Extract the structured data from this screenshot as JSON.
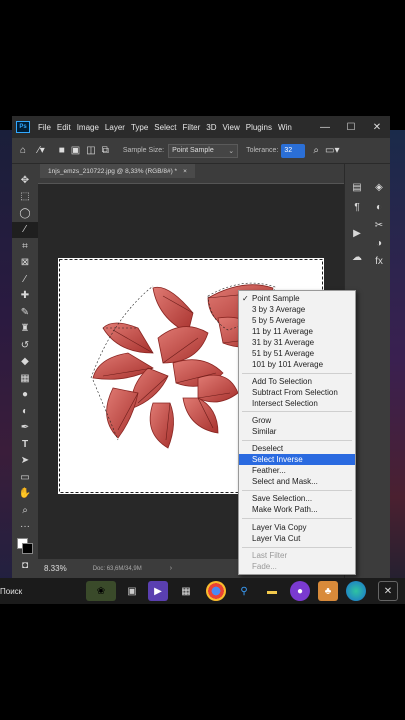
{
  "app": {
    "logo": "Ps",
    "menu": [
      "File",
      "Edit",
      "Image",
      "Layer",
      "Type",
      "Select",
      "Filter",
      "3D",
      "View",
      "Plugins",
      "Win"
    ],
    "window_buttons": [
      "—",
      "☐",
      "✕"
    ]
  },
  "options_bar": {
    "sample_size_label": "Sample Size:",
    "sample_size_value": "Point Sample",
    "tolerance_label": "Tolerance:",
    "tolerance_value": "32"
  },
  "document": {
    "tab_title": "1njѕ_emzs_210722.jpg @ 8,33% (RGB/8#) *",
    "tab_close": "×",
    "zoom": "8.33%",
    "doc_size": "Doc: 63,6M/34,9M",
    "status_arrow": "›"
  },
  "context_menu": {
    "items": [
      {
        "label": "Point Sample",
        "checked": true
      },
      {
        "label": "3 by 3 Average"
      },
      {
        "label": "5 by 5 Average"
      },
      {
        "label": "11 by 11 Average"
      },
      {
        "label": "31 by 31 Average"
      },
      {
        "label": "51 by 51 Average"
      },
      {
        "label": "101 by 101 Average"
      },
      {
        "label": "Add To Selection"
      },
      {
        "label": "Subtract From Selection"
      },
      {
        "label": "Intersect Selection"
      },
      {
        "label": "Grow"
      },
      {
        "label": "Similar"
      },
      {
        "label": "Deselect"
      },
      {
        "label": "Select Inverse",
        "highlighted": true
      },
      {
        "label": "Feather..."
      },
      {
        "label": "Select and Mask..."
      },
      {
        "label": "Save Selection..."
      },
      {
        "label": "Make Work Path..."
      },
      {
        "label": "Layer Via Copy"
      },
      {
        "label": "Layer Via Cut"
      },
      {
        "label": "Last Filter",
        "disabled": true
      },
      {
        "label": "Fade...",
        "disabled": true
      }
    ],
    "check_mark": "✓"
  },
  "taskbar": {
    "search_label": "Поиск"
  },
  "colors": {
    "menu_highlight": "#2a6ae0",
    "tolerance_highlight": "#2b6fd6",
    "leaf": "#c94a45"
  }
}
